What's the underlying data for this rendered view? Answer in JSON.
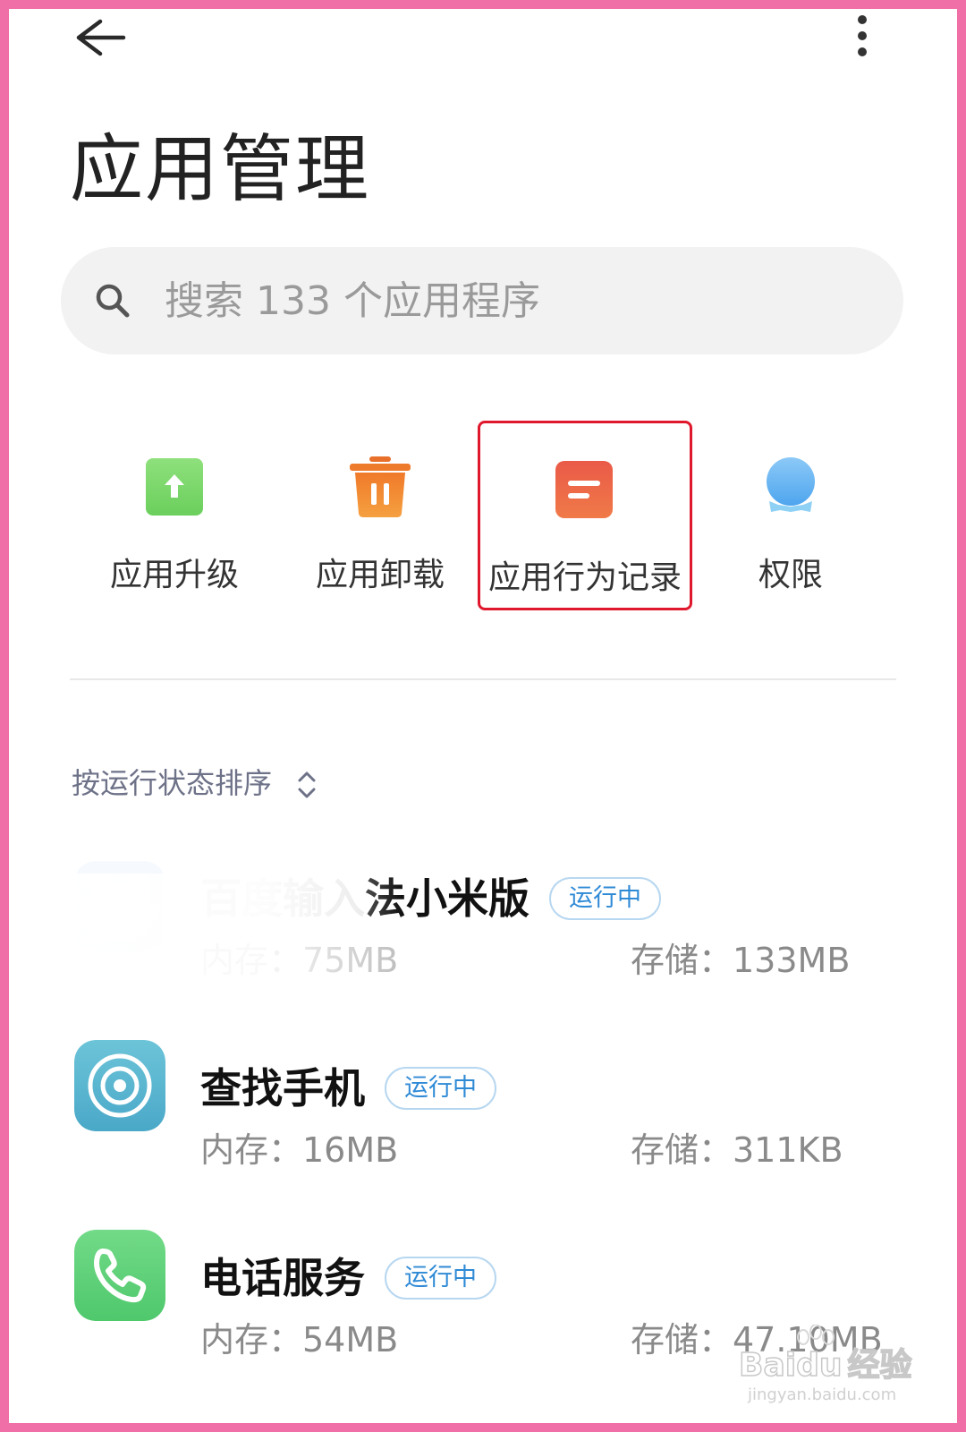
{
  "header": {
    "back_icon": "arrow-left-icon",
    "more_icon": "more-vertical-icon",
    "title": "应用管理"
  },
  "search": {
    "placeholder": "搜索 133 个应用程序",
    "value": "",
    "icon": "search-icon"
  },
  "shortcuts": [
    {
      "label": "应用升级",
      "icon": "upgrade-icon",
      "color": "#7bd66a"
    },
    {
      "label": "应用卸载",
      "icon": "trash-icon",
      "color": "#f08a2e"
    },
    {
      "label": "应用行为记录",
      "icon": "record-icon",
      "color": "#e8584a",
      "highlighted": true
    },
    {
      "label": "权限",
      "icon": "permission-icon",
      "color": "#5aaaf0"
    }
  ],
  "highlight_color": "#e0182d",
  "sort": {
    "label": "按运行状态排序",
    "icon": "chevron-updown-icon"
  },
  "apps": [
    {
      "name": "百度输入法小米版",
      "visible_name": "法小米版",
      "status": "运行中",
      "memory": "内存：75MB",
      "storage": "存储：133MB",
      "icon": "baidu-ime-icon"
    },
    {
      "name": "查找手机",
      "status": "运行中",
      "memory": "内存：16MB",
      "storage": "存储：311KB",
      "icon": "find-device-icon",
      "color": "#5bb8d4"
    },
    {
      "name": "电话服务",
      "status": "运行中",
      "memory": "内存：54MB",
      "storage": "存储：47.10MB",
      "icon": "phone-icon",
      "color": "#5ed17a"
    }
  ],
  "watermark": {
    "brand": "Bai",
    "brand2": "du",
    "brand3": "经验",
    "url": "jingyan.baidu.com"
  },
  "colors": {
    "frame": "#ef6fa6",
    "badge_text": "#2f8ad6",
    "badge_border": "#b7d7f0"
  }
}
